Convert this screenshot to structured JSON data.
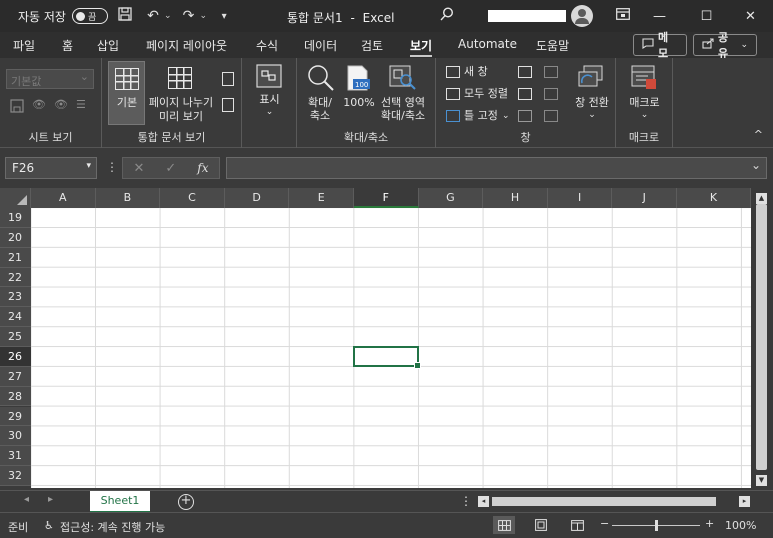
{
  "titlebar": {
    "autosave_label": "자동 저장",
    "autosave_state": "끔",
    "title": "통합 문서1",
    "separator": "-",
    "app_name": "Excel",
    "undo_caret": "⌄",
    "redo_caret": "⌄",
    "customize": "▾",
    "minimize": "—",
    "maximize": "☐",
    "close": "✕"
  },
  "menu": {
    "tabs": [
      "파일",
      "홈",
      "삽입",
      "페이지 레이아웃",
      "수식",
      "데이터",
      "검토",
      "보기",
      "Automate",
      "도움말"
    ],
    "active_tab": "보기",
    "memo_button": "메모",
    "share_button": "공유",
    "share_caret": "⌄"
  },
  "ribbon": {
    "sheet_view": {
      "dropdown_value": "기본값",
      "group_label": "시트 보기"
    },
    "workbook_views": {
      "normal": "기본",
      "page_break_line1": "페이지 나누기",
      "page_break_line2": "미리 보기",
      "group_label": "통합 문서 보기"
    },
    "show": {
      "label": "표시",
      "caret": "⌄"
    },
    "zoom": {
      "zoom_line1": "확대/",
      "zoom_line2": "축소",
      "hundred": "100%",
      "badge": "100",
      "zoom_sel_line1": "선택 영역",
      "zoom_sel_line2": "확대/축소",
      "group_label": "확대/축소"
    },
    "window": {
      "new_window": "새 창",
      "arrange_all": "모두 정렬",
      "freeze_panes": "틀 고정",
      "freeze_caret": "⌄",
      "switch_windows": "창 전환",
      "switch_caret": "⌄",
      "group_label": "창"
    },
    "macros": {
      "label": "매크로",
      "caret": "⌄",
      "group_label": "매크로"
    }
  },
  "formula_bar": {
    "name_box": "F26",
    "name_caret": "▾",
    "cancel": "✕",
    "enter": "✓",
    "fx": "fx",
    "formula_value": ""
  },
  "grid": {
    "columns": [
      "A",
      "B",
      "C",
      "D",
      "E",
      "F",
      "G",
      "H",
      "I",
      "J",
      "K"
    ],
    "selected_column": "F",
    "rows": [
      "19",
      "20",
      "21",
      "22",
      "23",
      "24",
      "25",
      "26",
      "27",
      "28",
      "29",
      "30",
      "31",
      "32"
    ],
    "selected_row": "26"
  },
  "sheet_tabs": {
    "tabs": [
      "Sheet1"
    ],
    "add_sheet": "+"
  },
  "status_bar": {
    "ready": "준비",
    "accessibility": "접근성: 계속 진행 가능",
    "zoom_minus": "−",
    "zoom_plus": "+",
    "zoom_level": "100%"
  }
}
